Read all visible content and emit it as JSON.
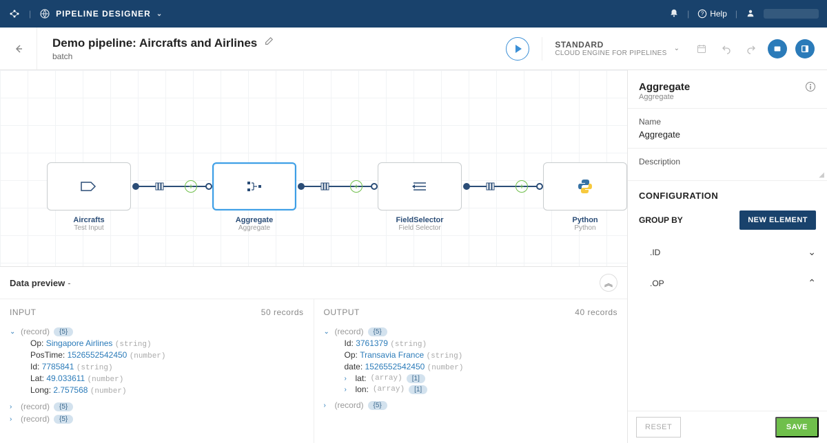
{
  "nav": {
    "brand": "PIPELINE DESIGNER",
    "help": "Help"
  },
  "header": {
    "title": "Demo pipeline: Aircrafts and Airlines",
    "subtitle": "batch",
    "engine_std": "STANDARD",
    "engine_sub": "CLOUD ENGINE FOR PIPELINES"
  },
  "nodes": [
    {
      "id": "n1",
      "title": "Aircrafts",
      "sub": "Test Input"
    },
    {
      "id": "n2",
      "title": "Aggregate",
      "sub": "Aggregate"
    },
    {
      "id": "n3",
      "title": "FieldSelector",
      "sub": "Field Selector"
    },
    {
      "id": "n4",
      "title": "Python",
      "sub": "Python"
    }
  ],
  "preview": {
    "header": "Data preview",
    "dash": "-",
    "input": {
      "title": "INPUT",
      "count": "50 records",
      "root_type": "(record)",
      "root_badge": "{5}",
      "fields": [
        {
          "k": "Op:",
          "v": "Singapore Airlines",
          "t": "(string)"
        },
        {
          "k": "PosTime:",
          "v": "1526552542450",
          "t": "(number)"
        },
        {
          "k": "Id:",
          "v": "7785841",
          "t": "(string)"
        },
        {
          "k": "Lat:",
          "v": "49.033611",
          "t": "(number)"
        },
        {
          "k": "Long:",
          "v": "2.757568",
          "t": "(number)"
        }
      ],
      "collapsed": [
        {
          "type": "(record)",
          "badge": "{5}"
        },
        {
          "type": "(record)",
          "badge": "{5}"
        }
      ]
    },
    "output": {
      "title": "OUTPUT",
      "count": "40 records",
      "root_type": "(record)",
      "root_badge": "{5}",
      "fields": [
        {
          "k": "Id:",
          "v": "3761379",
          "t": "(string)"
        },
        {
          "k": "Op:",
          "v": "Transavia France",
          "t": "(string)"
        },
        {
          "k": "date:",
          "v": "1526552542450",
          "t": "(number)"
        }
      ],
      "arrays": [
        {
          "k": "lat:",
          "t": "(array)",
          "badge": "[1]"
        },
        {
          "k": "lon:",
          "t": "(array)",
          "badge": "[1]"
        }
      ],
      "collapsed": [
        {
          "type": "(record)",
          "badge": "{5}"
        }
      ]
    }
  },
  "panel": {
    "title": "Aggregate",
    "subtitle": "Aggregate",
    "name_label": "Name",
    "name_value": "Aggregate",
    "desc_label": "Description",
    "conf_title": "CONFIGURATION",
    "group_by": "GROUP BY",
    "new_element": "NEW ELEMENT",
    "groups": [
      {
        "field": ".ID",
        "open": false
      },
      {
        "field": ".OP",
        "open": true
      }
    ],
    "reset": "RESET",
    "save": "SAVE"
  }
}
